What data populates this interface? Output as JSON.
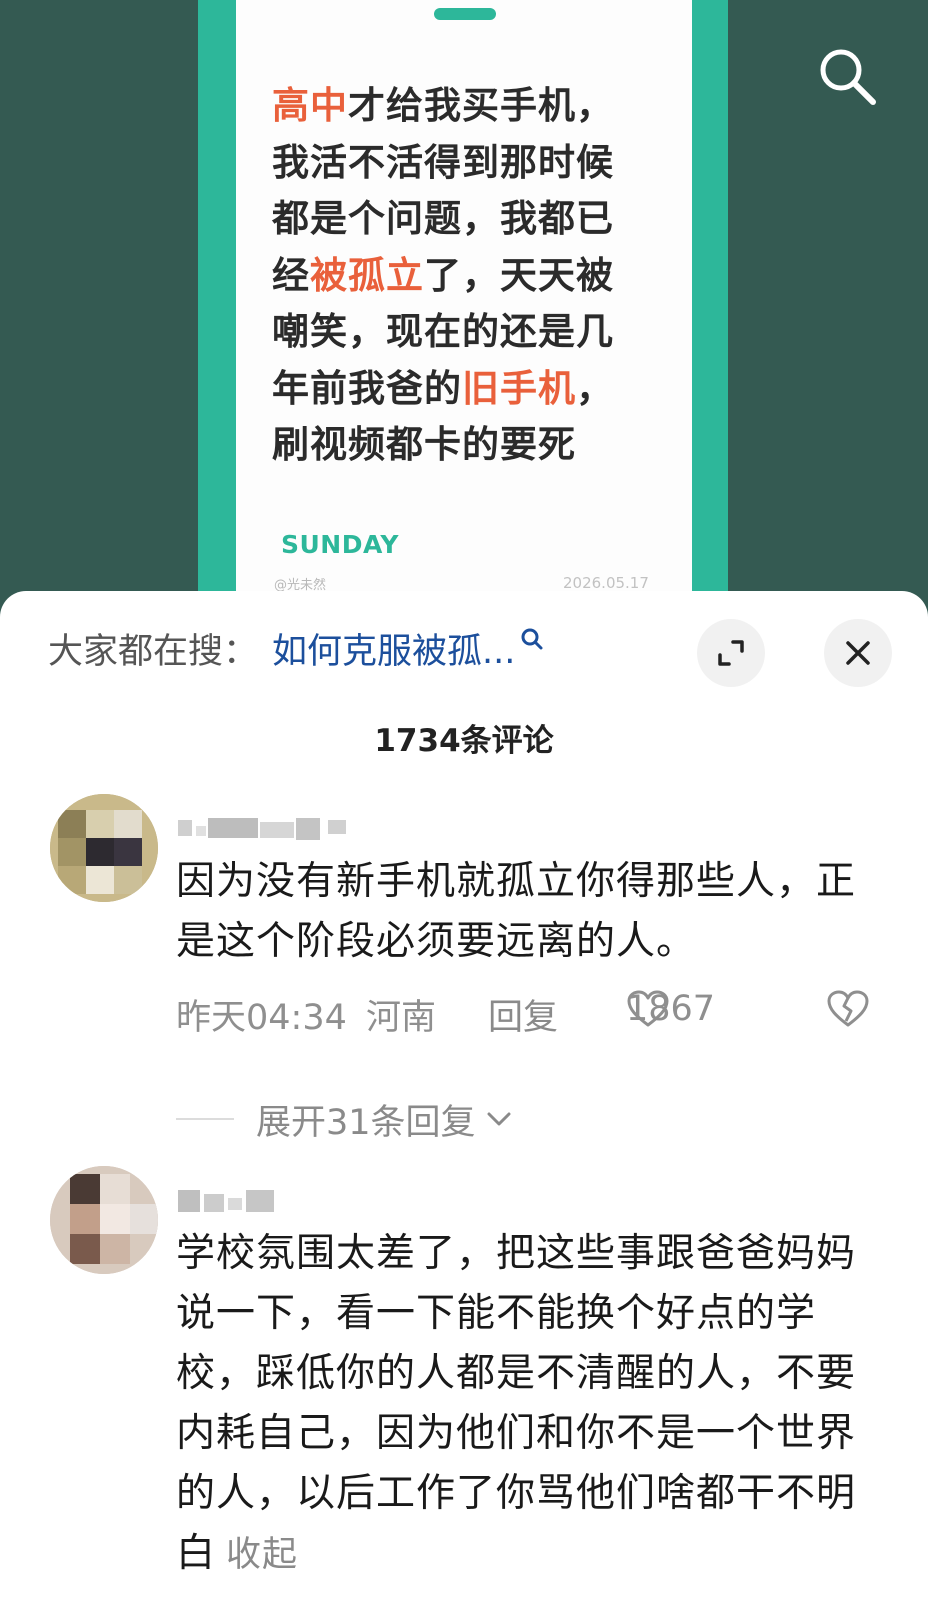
{
  "video": {
    "quote_segments": [
      {
        "text": "高中",
        "highlight": true
      },
      {
        "text": "才给我买手机，",
        "highlight": false
      },
      {
        "text": "我活不活得到那时候",
        "highlight": false
      },
      {
        "text": "都是个问题，我都已",
        "highlight": false
      },
      {
        "text": "经",
        "highlight": false
      },
      {
        "text": "被孤立",
        "highlight": true
      },
      {
        "text": "了，天天被",
        "highlight": false
      },
      {
        "text": "嘲笑，现在的还是几",
        "highlight": false
      },
      {
        "text": "年前我爸的",
        "highlight": false
      },
      {
        "text": "旧手机",
        "highlight": true
      },
      {
        "text": "，",
        "highlight": false
      },
      {
        "text": "刷视频都卡的要死",
        "highlight": false
      }
    ],
    "brand": "SUNDAY",
    "watermark": "@光未然",
    "date": "2026.05.17",
    "search_icon": "search-icon",
    "colors": {
      "accent": "#2db79a",
      "highlight": "#e9603b",
      "background": "#345a52"
    }
  },
  "sheet": {
    "hot_search_prefix": "大家都在搜：",
    "hot_search_query": "如何克服被孤...",
    "expand_icon": "expand-icon",
    "close_icon": "close-icon",
    "comment_count_title": "1734条评论",
    "comments": [
      {
        "username": "",
        "text": "因为没有新手机就孤立你得那些人，正是这个阶段必须要远离的人。",
        "time": "昨天04:34",
        "location": "河南",
        "reply_label": "回复",
        "likes": "1867",
        "expand_replies": "展开31条回复"
      },
      {
        "username": "",
        "text": "学校氛围太差了，把这些事跟爸爸妈妈说一下，看一下能不能换个好点的学校，踩低你的人都是不清醒的人，不要内耗自己，因为他们和你不是一个世界的人，以后工作了你骂他们啥都干不明白",
        "fold_label": "收起"
      }
    ]
  }
}
